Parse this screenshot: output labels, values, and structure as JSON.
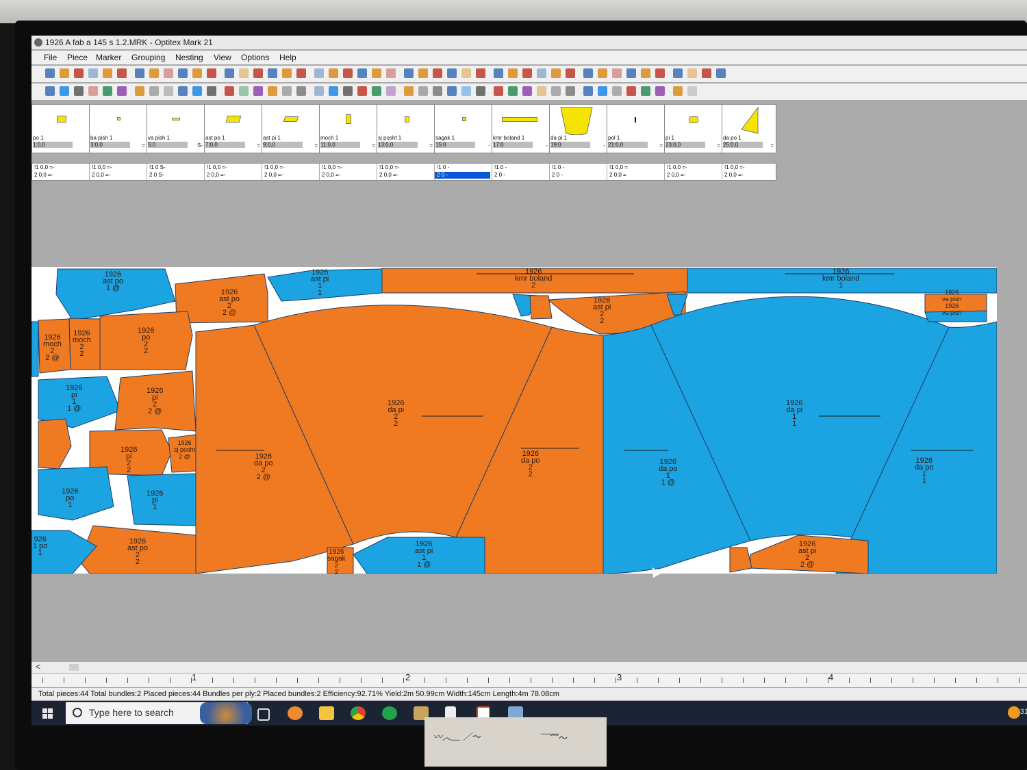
{
  "window": {
    "title": "1926 A fab a 145 s 1.2.MRK - Optitex Mark 21"
  },
  "menu": [
    "File",
    "Piece",
    "Marker",
    "Grouping",
    "Nesting",
    "View",
    "Options",
    "Help"
  ],
  "piece_tiles": [
    {
      "name": "po 1",
      "value": "1:0,0",
      "suffix": "="
    },
    {
      "name": "ba pish 1",
      "value": "3:0,0",
      "suffix": "="
    },
    {
      "name": "va pish 1",
      "value": "5:0",
      "suffix": "S-"
    },
    {
      "name": "ast po 1",
      "value": "7:0,0",
      "suffix": "="
    },
    {
      "name": "ast pi 1",
      "value": "9:0,0",
      "suffix": "="
    },
    {
      "name": "moch 1",
      "value": "11:0,0",
      "suffix": "="
    },
    {
      "name": "sj posht 1",
      "value": "13:0,0",
      "suffix": "="
    },
    {
      "name": "sagak 1",
      "value": "15:0",
      "suffix": "-"
    },
    {
      "name": "kmr boland 1",
      "value": "17:0",
      "suffix": "-"
    },
    {
      "name": "da pi 1",
      "value": "19:0",
      "suffix": "-"
    },
    {
      "name": "pol 1",
      "value": "21:0,0",
      "suffix": "="
    },
    {
      "name": "pi 1",
      "value": "23:0,0",
      "suffix": "="
    },
    {
      "name": "da po 1",
      "value": "25:0,0",
      "suffix": "="
    }
  ],
  "quantity_rows": [
    {
      "r1": "!1  0,0 =-",
      "r2": "2  0,0 =-"
    },
    {
      "r1": "!1  0,0 =-",
      "r2": "2  0,0 =-"
    },
    {
      "r1": "!1  0  S-",
      "r2": "2  0  S-"
    },
    {
      "r1": "!1  0,0 =-",
      "r2": "2  0,0 =-"
    },
    {
      "r1": "!1  0,0 =-",
      "r2": "2  0,0 =-"
    },
    {
      "r1": "!1  0,0 =-",
      "r2": "2  0,0 =-"
    },
    {
      "r1": "!1  0,0 =-",
      "r2": "2  0,0 =-"
    },
    {
      "r1": "!1  0  -",
      "r2": "2  0  -"
    },
    {
      "r1": "!1  0  -",
      "r2": "2  0  -"
    },
    {
      "r1": "!1  0  -",
      "r2": "2  0  -"
    },
    {
      "r1": "!1  0,0 =",
      "r2": "2  0,0 ="
    },
    {
      "r1": "!1  0,0 =-",
      "r2": "2  0,0 =-"
    },
    {
      "r1": "!1  0,0 =-",
      "r2": "2  0,0 =-"
    }
  ],
  "marker_labels": [
    {
      "text": "1926\nast po\n1 @"
    },
    {
      "text": "1926\nast po\n2\n2 @"
    },
    {
      "text": "1926\nast pi\n1\n1"
    },
    {
      "text": "1926\nkmr boland\n2"
    },
    {
      "text": "1926\nkmr boland\n1"
    },
    {
      "text": "1926\nmoch\n2\n2 @"
    },
    {
      "text": "1926\nmoch\n2\n2"
    },
    {
      "text": "1926\npo\n2\n2"
    },
    {
      "text": "1926\nast pi\n2\n2"
    },
    {
      "text": "1926\nva pish\n1926\nva pish"
    },
    {
      "text": "1926\npi\n1\n1 @"
    },
    {
      "text": "1926\npi\n2\n2 @"
    },
    {
      "text": "1926\npi\n2\n2"
    },
    {
      "text": "1926\nsj posht\n2 @"
    },
    {
      "text": "1926\npo\n1"
    },
    {
      "text": "1926\npi\n1"
    },
    {
      "text": "1926\nast po\n2\n2"
    },
    {
      "text": "1926\nda pi\n2\n2"
    },
    {
      "text": "1926\nda po\n2\n2 @"
    },
    {
      "text": "1926\nda po\n2\n2"
    },
    {
      "text": "1926\nsagak\n2\n2"
    },
    {
      "text": "1926\nast pi\n1\n1 @"
    },
    {
      "text": "1926\nda pi\n1\n1"
    },
    {
      "text": "1926\nda po\n1\n1 @"
    },
    {
      "text": "1926\nda po\n1\n1"
    },
    {
      "text": "1926\nast pi\n2\n2 @"
    },
    {
      "text": "926\n1 po\n1"
    }
  ],
  "ruler_numbers": [
    "1",
    "2",
    "3",
    "4"
  ],
  "status": {
    "text": "Total pieces:44  Total bundles:2  Placed pieces:44  Bundles per ply:2  Placed bundles:2  Efficiency:92.71%  Yield:2m 50.99cm  Width:145cm  Length:4m 78.08cm"
  },
  "taskbar": {
    "search_placeholder": "Type here to search",
    "tray_number": "31"
  },
  "colors": {
    "orange": "#f07a22",
    "blue": "#1ca3e2",
    "marker_bg": "#ffffff",
    "screen_bg": "#ababab",
    "tile_shape": "#f4e400"
  }
}
